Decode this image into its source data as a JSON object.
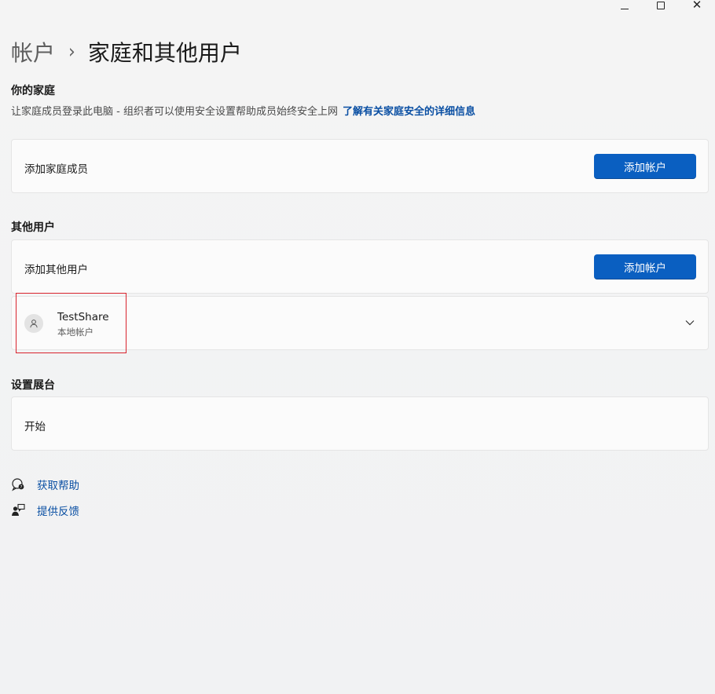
{
  "window": {
    "controls": {
      "minimize_icon": "minimize-icon",
      "maximize_icon": "maximize-icon",
      "close_icon": "close-icon",
      "close_glyph": "✕"
    }
  },
  "breadcrumb": {
    "parent": "帐户",
    "separator": "›",
    "current": "家庭和其他用户"
  },
  "family": {
    "title": "你的家庭",
    "description": "让家庭成员登录此电脑 - 组织者可以使用安全设置帮助成员始终安全上网",
    "learn_more_link": "了解有关家庭安全的详细信息",
    "add_member_label": "添加家庭成员",
    "add_member_button": "添加帐户"
  },
  "other_users": {
    "title": "其他用户",
    "add_user_label": "添加其他用户",
    "add_user_button": "添加帐户",
    "users": [
      {
        "name": "TestShare",
        "type": "本地帐户",
        "icon": "person-icon"
      }
    ]
  },
  "kiosk": {
    "title": "设置展台",
    "start_label": "开始"
  },
  "help": {
    "get_help": "获取帮助",
    "feedback": "提供反馈"
  },
  "colors": {
    "accent": "#0a5fc1",
    "link": "#0a4fa3",
    "highlight": "#d9232d"
  }
}
